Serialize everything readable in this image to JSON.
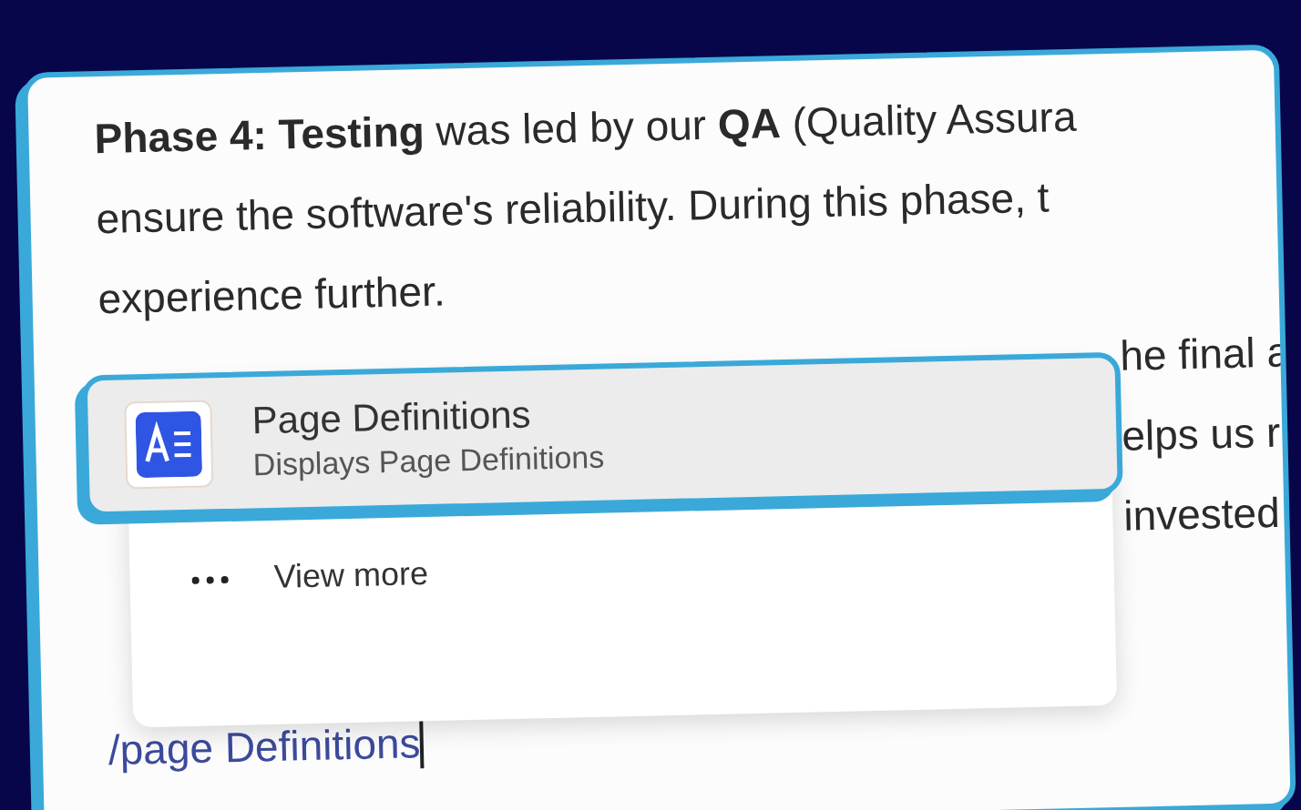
{
  "editor": {
    "paragraph_lines": [
      "**Phase 4: Testing** was led by our **QA** (Quality Assura",
      "ensure the software's reliability. During this phase, t",
      "experience further."
    ],
    "covered_lines": [
      "he final a",
      "elps us r",
      "invested"
    ],
    "command_menu": {
      "items": [
        {
          "kind": "command",
          "title": "Page Definitions",
          "description": "Displays Page Definitions",
          "selected": true
        },
        {
          "kind": "more",
          "title": "View more",
          "selected": false
        }
      ]
    },
    "command_input": {
      "value": "/page Definitions"
    }
  }
}
